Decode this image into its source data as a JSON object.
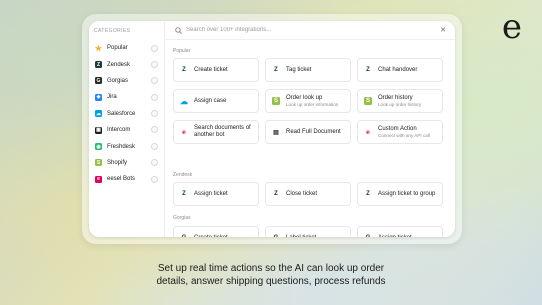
{
  "brand": {
    "logo": "e"
  },
  "sidebar": {
    "title": "CATEGORIES",
    "items": [
      {
        "label": "Popular",
        "icon": "star-icon",
        "color": "#f0b429"
      },
      {
        "label": "Zendesk",
        "icon": "zendesk-icon",
        "color": "#1f3b3a"
      },
      {
        "label": "Gorgias",
        "icon": "gorgias-icon",
        "color": "#2b2b2b"
      },
      {
        "label": "Jira",
        "icon": "jira-icon",
        "color": "#2684ff"
      },
      {
        "label": "Salesforce",
        "icon": "salesforce-icon",
        "color": "#00a1e0"
      },
      {
        "label": "Intercom",
        "icon": "intercom-icon",
        "color": "#1f1f1f"
      },
      {
        "label": "Freshdesk",
        "icon": "freshdesk-icon",
        "color": "#25c16f"
      },
      {
        "label": "Shopify",
        "icon": "shopify-icon",
        "color": "#95bf47"
      },
      {
        "label": "eesel Bots",
        "icon": "eesel-icon",
        "color": "#e4005b"
      }
    ]
  },
  "search": {
    "placeholder": "Search over 100+ integrations..."
  },
  "sections": [
    {
      "label": "Popular",
      "cards": [
        {
          "title": "Create ticket",
          "sub": "",
          "icon": "zendesk-icon"
        },
        {
          "title": "Tag ticket",
          "sub": "",
          "icon": "zendesk-icon"
        },
        {
          "title": "Chat handover",
          "sub": "",
          "icon": "zendesk-icon"
        },
        {
          "title": "Assign case",
          "sub": "",
          "icon": "salesforce-icon"
        },
        {
          "title": "Order look up",
          "sub": "Look up order information",
          "icon": "shopify-icon"
        },
        {
          "title": "Order history",
          "sub": "Look up order history",
          "icon": "shopify-icon"
        },
        {
          "title": "Search documents of another bot",
          "sub": "",
          "icon": "eesel-icon"
        },
        {
          "title": "Read Full Document",
          "sub": "",
          "icon": "document-icon"
        },
        {
          "title": "Custom Action",
          "sub": "Connect with any API call",
          "icon": "eesel-icon"
        }
      ]
    },
    {
      "label": "Zendesk",
      "cards": [
        {
          "title": "Assign ticket",
          "sub": "",
          "icon": "zendesk-icon"
        },
        {
          "title": "Close ticket",
          "sub": "",
          "icon": "zendesk-icon"
        },
        {
          "title": "Assign ticket to group",
          "sub": "",
          "icon": "zendesk-icon"
        }
      ]
    },
    {
      "label": "Gorgias",
      "cards": [
        {
          "title": "Create ticket",
          "sub": "",
          "icon": "gorgias-icon"
        },
        {
          "title": "Label ticket",
          "sub": "",
          "icon": "gorgias-icon"
        },
        {
          "title": "Assign ticket",
          "sub": "",
          "icon": "gorgias-icon"
        }
      ]
    }
  ],
  "caption": {
    "line1": "Set up real time actions so the AI can look up order",
    "line2": "details, answer shipping questions, process refunds"
  },
  "colors": {
    "zendesk": "#03363d",
    "shopify": "#95bf47",
    "salesforce": "#00a1e0",
    "eesel": "#e4005b"
  }
}
